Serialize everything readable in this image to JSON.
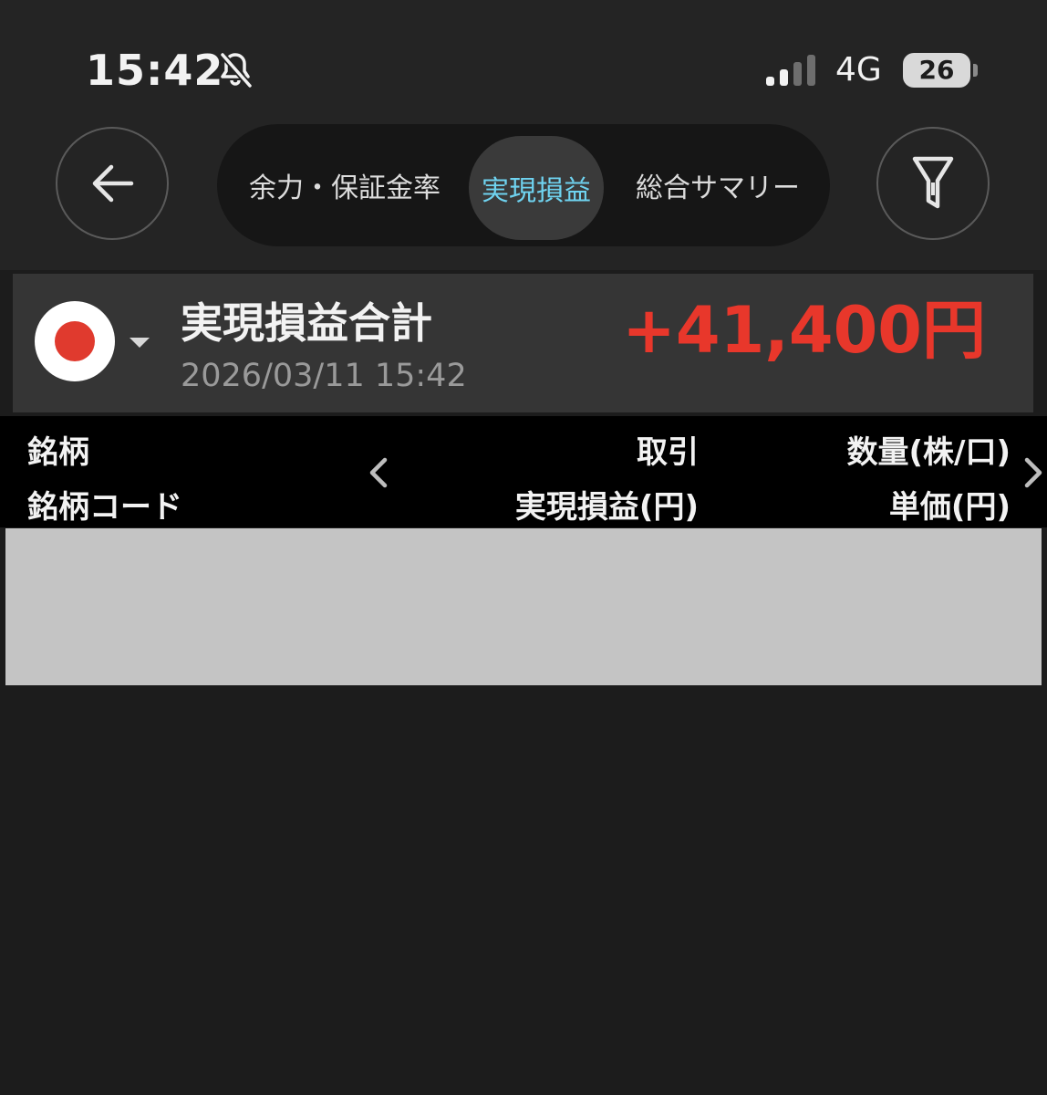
{
  "status_bar": {
    "time": "15:42",
    "network": "4G",
    "battery": "26"
  },
  "nav": {
    "tabs": [
      {
        "label": "余力・保証金率",
        "active": false
      },
      {
        "label": "実現損益",
        "active": true
      },
      {
        "label": "総合サマリー",
        "active": false
      }
    ]
  },
  "summary": {
    "title": "実現損益合計",
    "date": "2026/03/11 15:42",
    "amount": "+41,400円",
    "amount_color": "#e8372b"
  },
  "table_header": {
    "col1_top": "銘柄",
    "col1_bottom": "銘柄コード",
    "col2_top": "取引",
    "col2_bottom": "実現損益(円)",
    "col3_top": "数量(株/口)",
    "col3_bottom": "単価(円)"
  },
  "colors": {
    "active_tab": "#6fd3f0",
    "background": "#1c1c1c"
  }
}
